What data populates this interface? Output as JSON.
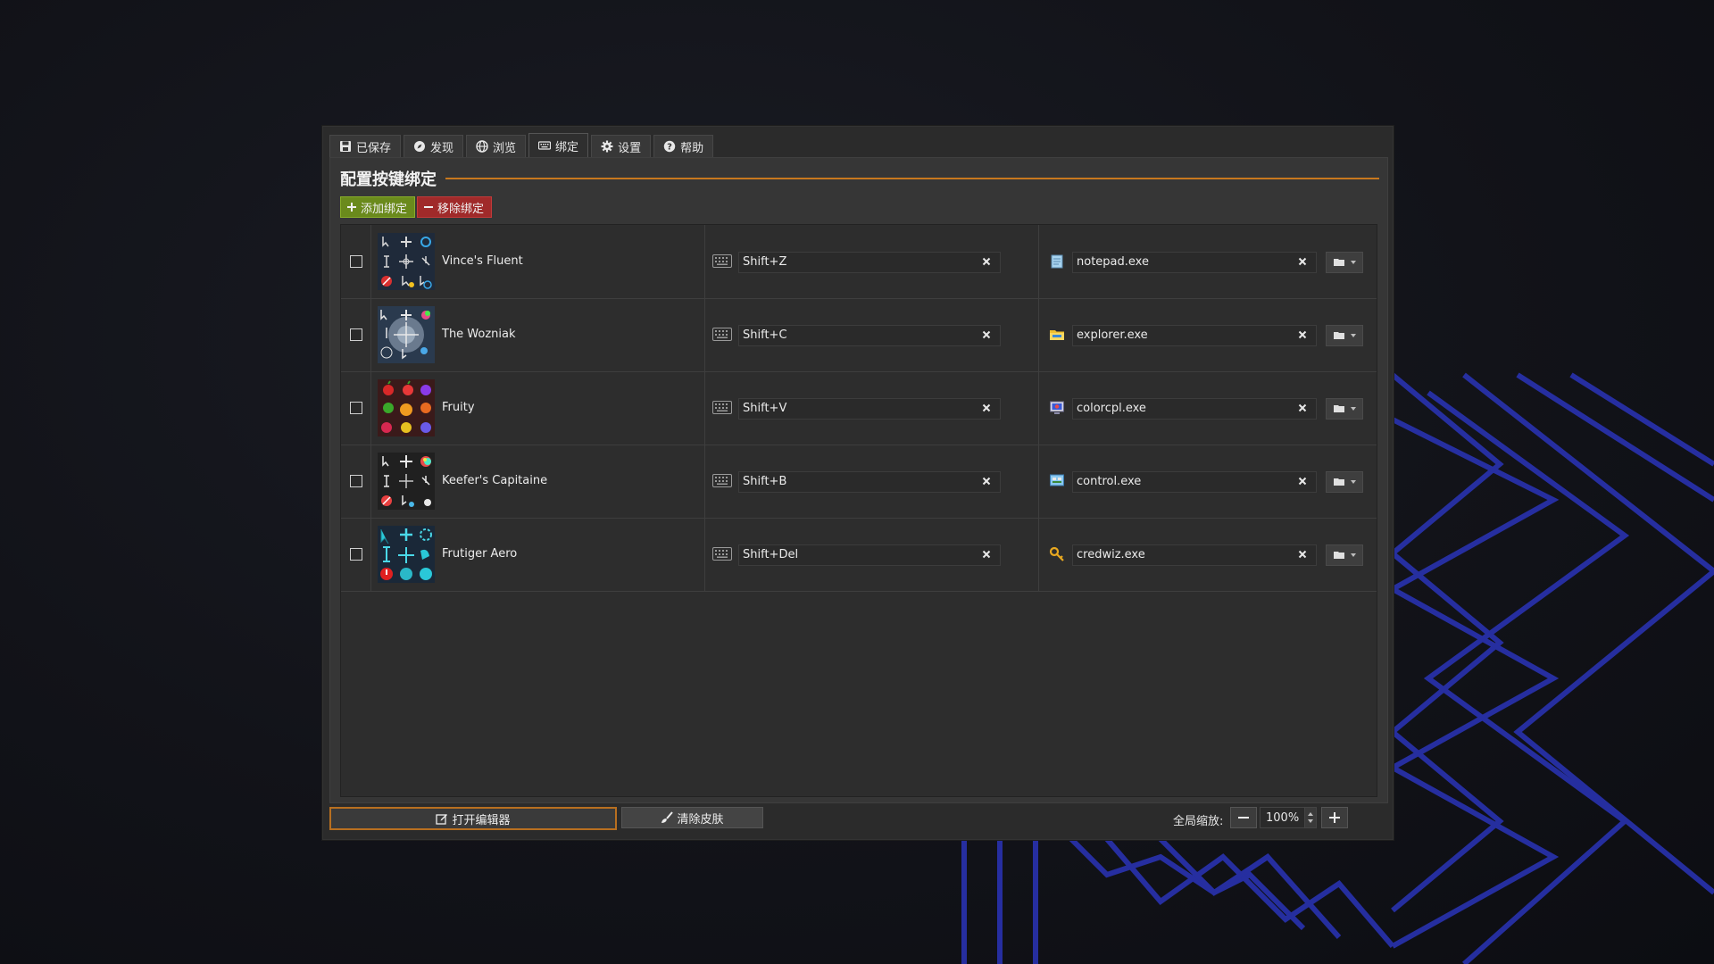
{
  "tabs": [
    {
      "icon": "floppy-icon",
      "label": "已保存"
    },
    {
      "icon": "compass-icon",
      "label": "发现"
    },
    {
      "icon": "globe-icon",
      "label": "浏览"
    },
    {
      "icon": "keyboard-icon",
      "label": "绑定",
      "active": true
    },
    {
      "icon": "gear-icon",
      "label": "设置"
    },
    {
      "icon": "question-icon",
      "label": "帮助"
    }
  ],
  "page": {
    "title": "配置按键绑定",
    "add_label": "添加绑定",
    "remove_label": "移除绑定",
    "accent": "#c8781e"
  },
  "bindings": [
    {
      "skin": "Vince's Fluent",
      "hotkey": "Shift+Z",
      "process": "notepad.exe",
      "process_icon": "notepad-icon"
    },
    {
      "skin": "The Wozniak",
      "hotkey": "Shift+C",
      "process": "explorer.exe",
      "process_icon": "folder-icon"
    },
    {
      "skin": "Fruity",
      "hotkey": "Shift+V",
      "process": "colorcpl.exe",
      "process_icon": "monitor-icon"
    },
    {
      "skin": "Keefer's Capitaine",
      "hotkey": "Shift+B",
      "process": "control.exe",
      "process_icon": "control-panel-icon"
    },
    {
      "skin": "Frutiger Aero",
      "hotkey": "Shift+Del",
      "process": "credwiz.exe",
      "process_icon": "key-icon"
    }
  ],
  "footer": {
    "open_editor_label": "打开编辑器",
    "clear_skin_label": "清除皮肤",
    "zoom_label": "全局缩放:",
    "zoom_value": "100%"
  }
}
